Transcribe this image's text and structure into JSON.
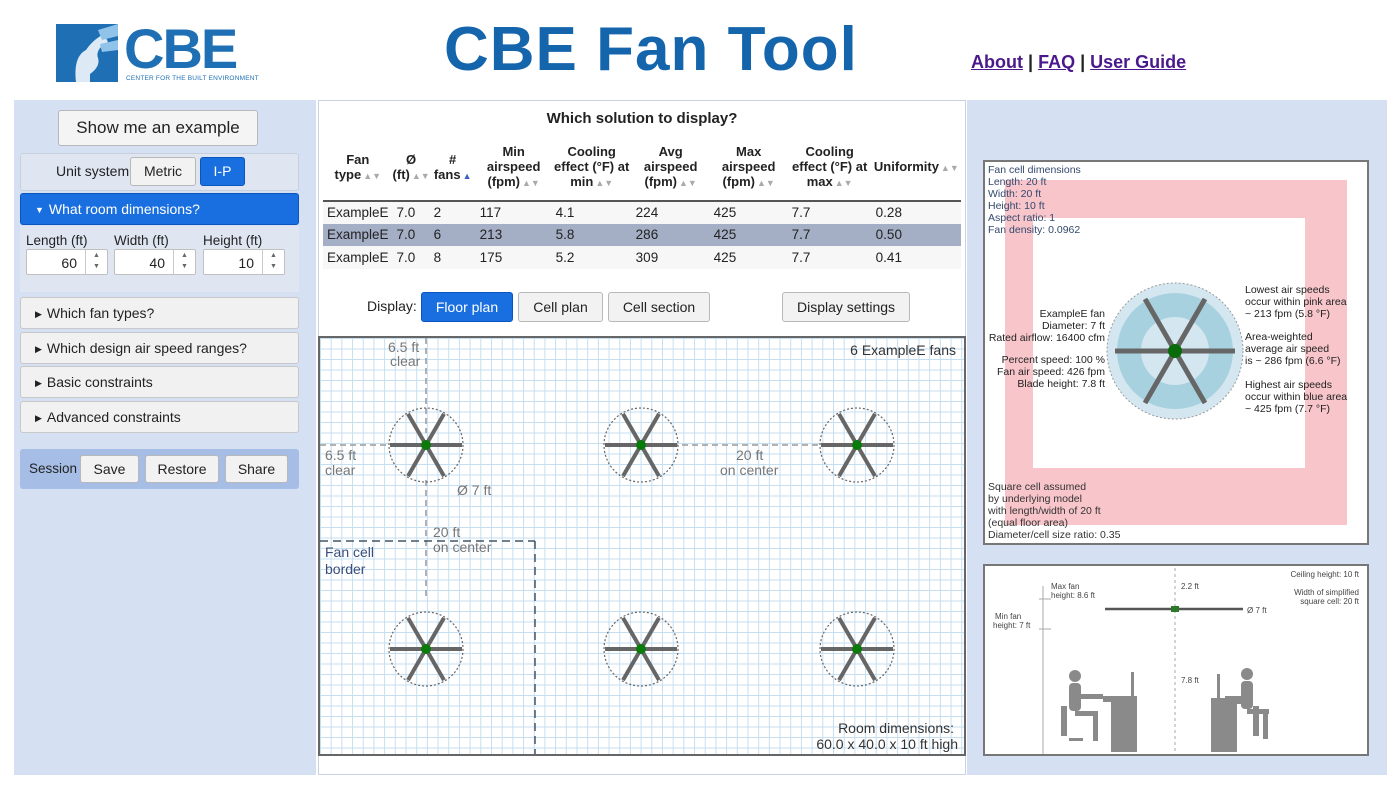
{
  "header": {
    "logo_text": "CBE",
    "logo_sub": "CENTER FOR THE BUILT ENVIRONMENT",
    "title": "CBE Fan Tool",
    "links": [
      "About",
      "FAQ",
      "User Guide"
    ],
    "sep": "|"
  },
  "left": {
    "show_example": "Show me an example",
    "unit_label": "Unit system",
    "unit_metric": "Metric",
    "unit_ip": "I-P",
    "room_dims": "What room dimensions?",
    "length_label": "Length (ft)",
    "width_label": "Width (ft)",
    "height_label": "Height (ft)",
    "length": "60",
    "width": "40",
    "height": "10",
    "fan_types": "Which fan types?",
    "air_speed": "Which design air speed ranges?",
    "basic": "Basic constraints",
    "advanced": "Advanced constraints",
    "session": "Session",
    "save": "Save",
    "restore": "Restore",
    "share": "Share"
  },
  "table": {
    "title": "Which solution to display?",
    "headers": [
      "Fan type",
      "Ø (ft)",
      "# fans",
      "Min airspeed (fpm)",
      "Cooling effect (°F) at min",
      "Avg airspeed (fpm)",
      "Max airspeed (fpm)",
      "Cooling effect (°F) at max",
      "Uniformity"
    ],
    "rows": [
      [
        "ExampleE",
        "7.0",
        "2",
        "117",
        "4.1",
        "224",
        "425",
        "7.7",
        "0.28"
      ],
      [
        "ExampleE",
        "7.0",
        "6",
        "213",
        "5.8",
        "286",
        "425",
        "7.7",
        "0.50"
      ],
      [
        "ExampleE",
        "7.0",
        "8",
        "175",
        "5.2",
        "309",
        "425",
        "7.7",
        "0.41"
      ]
    ]
  },
  "display": {
    "label": "Display:",
    "floor_plan": "Floor plan",
    "cell_plan": "Cell plan",
    "cell_section": "Cell section",
    "settings": "Display settings"
  },
  "floorplan": {
    "fan_count": "6 ExampleE fans",
    "clear_top_1": "6.5 ft",
    "clear_top_2": "clear",
    "clear_left_1": "6.5 ft",
    "clear_left_2": "clear",
    "oc_h_1": "20 ft",
    "oc_h_2": "on center",
    "oc_v_1": "20 ft",
    "oc_v_2": "on center",
    "diameter": "Ø 7 ft",
    "cell_border_1": "Fan cell",
    "cell_border_2": "border",
    "room_dims_1": "Room dimensions:",
    "room_dims_2": "60.0 x 40.0 x 10 ft high"
  },
  "cell": {
    "dims_title": "Fan cell dimensions",
    "length": "Length:  20 ft",
    "width": "Width:  20 ft",
    "height": "Height:  10 ft",
    "aspect": "Aspect ratio: 1",
    "density": "Fan density: 0.0962",
    "fan_name": "ExampleE fan",
    "diameter": "Diameter: 7 ft",
    "airflow": "Rated airflow: 16400 cfm",
    "percent_speed": "Percent speed: 100 %",
    "fan_air_speed": "Fan air speed: 426 fpm",
    "blade_height": "Blade height: 7.8 ft",
    "lowest_1": "Lowest air speeds",
    "lowest_2": "occur within pink area",
    "lowest_3": "~ 213 fpm (5.8 °F)",
    "avg_1": "Area-weighted",
    "avg_2": "average air speed",
    "avg_3": "is ~ 286 fpm (6.6 °F)",
    "highest_1": "Highest air speeds",
    "highest_2": "occur within blue area",
    "highest_3": "~ 425 fpm (7.7 °F)",
    "square_1": "Square cell assumed",
    "square_2": "by underlying model",
    "square_3": "with length/width of 20 ft",
    "square_4": "(equal floor area)",
    "ratio": "Diameter/cell size ratio: 0.35"
  },
  "section": {
    "ceiling": "Ceiling height: 10 ft",
    "width_1": "Width of simplified",
    "width_2": "square cell: 20 ft",
    "max_fan_1": "Max fan",
    "max_fan_2": "height: 8.6 ft",
    "min_fan_1": "Min fan",
    "min_fan_2": "height: 7 ft",
    "clearance": "2.2 ft",
    "diameter": "Ø 7 ft",
    "blade": "7.8 ft"
  }
}
